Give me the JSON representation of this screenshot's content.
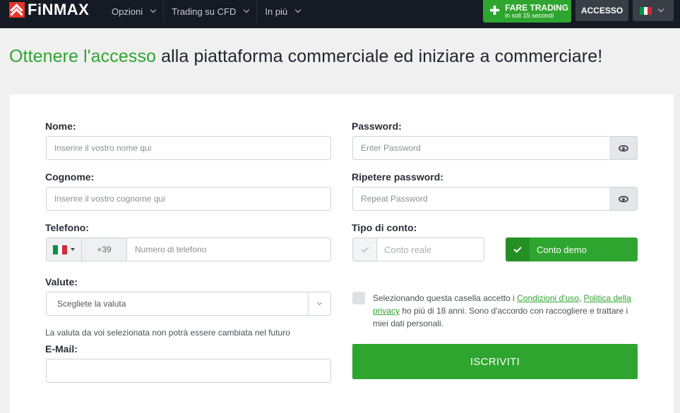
{
  "header": {
    "logo_text": "FiNMAX",
    "nav": [
      {
        "label": "Opzioni"
      },
      {
        "label": "Trading su CFD"
      },
      {
        "label": "In più"
      }
    ],
    "trade_button": {
      "label": "FARE TRADING",
      "sublabel": "in soli 15 secondi",
      "icon": "plus-icon"
    },
    "login_label": "ACCESSO",
    "language": {
      "flag": "italy-flag-icon",
      "colors": [
        "#009246",
        "#ffffff",
        "#ce2b37"
      ]
    }
  },
  "headline": {
    "highlight": "Ottenere l'accesso",
    "rest": " alla piattaforma commerciale ed iniziare a commerciare!"
  },
  "form": {
    "first_name": {
      "label": "Nome:",
      "placeholder": "Inserire il vostro nome qui"
    },
    "last_name": {
      "label": "Cognome:",
      "placeholder": "Inserire il vostro cognome qui"
    },
    "phone": {
      "label": "Telefono:",
      "country_code": "+39",
      "placeholder": "Numero di telefono"
    },
    "currency": {
      "label": "Valute:",
      "selected": "Scegliete la valuta",
      "note": "La valuta da voi selezionata non potrà essere cambiata nel futuro"
    },
    "email": {
      "label": "E-Mail:",
      "value": ""
    },
    "password": {
      "label": "Password:",
      "placeholder": "Enter Password"
    },
    "repeat_password": {
      "label": "Ripetere password:",
      "placeholder": "Repeat Password"
    },
    "account_type": {
      "label": "Tipo di conto:",
      "options": [
        "Conto reale",
        "Conto demo"
      ],
      "selected": "Conto demo"
    },
    "consent": {
      "text_before": "Selezionando questa casella accetto i ",
      "terms_link": "Condizioni d'uso",
      "sep": ", ",
      "privacy_link": "Politica della privacy",
      "text_after": " ho più di 18 anni. Sono d'accordo con raccogliere e trattare i miei dati personali."
    },
    "submit_label": "ISCRIVITI"
  },
  "colors": {
    "brand_green": "#2ea52e",
    "nav_bg": "#151a24",
    "logo_red": "#e8332a"
  }
}
